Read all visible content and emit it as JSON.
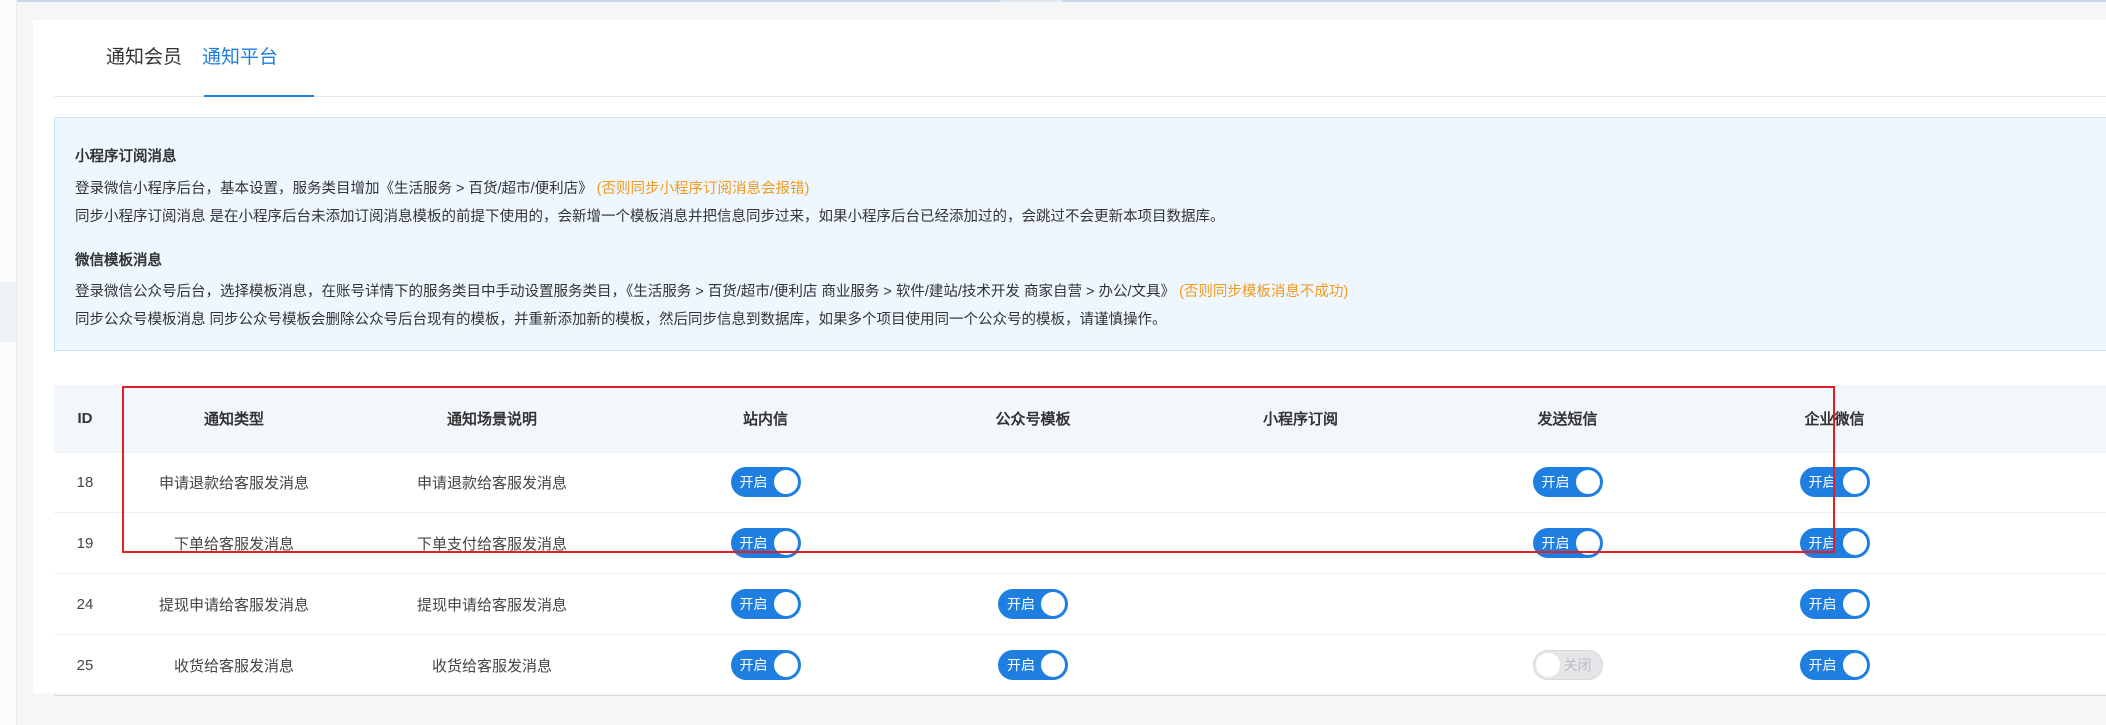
{
  "tabs": [
    {
      "label": "通知会员",
      "active": false
    },
    {
      "label": "通知平台",
      "active": true
    }
  ],
  "colors": {
    "accent": "#1e7fe0",
    "warning": "#f39a1b",
    "highlight": "#e31e24"
  },
  "notice": {
    "section1_title": "小程序订阅消息",
    "section1_line1": "登录微信小程序后台，基本设置，服务类目增加《生活服务 > 百货/超市/便利店》",
    "section1_line1_warn": "(否则同步小程序订阅消息会报错)",
    "section1_line2": "同步小程序订阅消息 是在小程序后台未添加订阅消息模板的前提下使用的，会新增一个模板消息并把信息同步过来，如果小程序后台已经添加过的，会跳过不会更新本项目数据库。",
    "section2_title": "微信模板消息",
    "section2_line1": "登录微信公众号后台，选择模板消息，在账号详情下的服务类目中手动设置服务类目，《生活服务 > 百货/超市/便利店 商业服务 > 软件/建站/技术开发 商家自营 > 办公/文具》",
    "section2_line1_warn": "(否则同步模板消息不成功)",
    "section2_line2": "同步公众号模板消息 同步公众号模板会删除公众号后台现有的模板，并重新添加新的模板，然后同步信息到数据库，如果多个项目使用同一个公众号的模板，请谨慎操作。"
  },
  "table": {
    "headers": {
      "id": "ID",
      "type": "通知类型",
      "desc": "通知场景说明",
      "site": "站内信",
      "gzh": "公众号模板",
      "mp": "小程序订阅",
      "sms": "发送短信",
      "wecom": "企业微信"
    },
    "switch_on_label": "开启",
    "switch_off_label": "关闭",
    "rows": [
      {
        "id": "18",
        "type": "申请退款给客服发消息",
        "desc": "申请退款给客服发消息"
      },
      {
        "id": "19",
        "type": "下单给客服发消息",
        "desc": "下单支付给客服发消息"
      },
      {
        "id": "24",
        "type": "提现申请给客服发消息",
        "desc": "提现申请给客服发消息"
      },
      {
        "id": "25",
        "type": "收货给客服发消息",
        "desc": "收货给客服发消息"
      }
    ]
  }
}
